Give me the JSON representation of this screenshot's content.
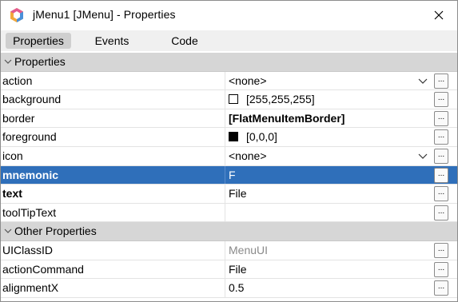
{
  "window": {
    "title": "jMenu1 [JMenu] - Properties"
  },
  "tabs": [
    {
      "label": "Properties",
      "active": true
    },
    {
      "label": "Events",
      "active": false
    },
    {
      "label": "Code",
      "active": false
    }
  ],
  "groups": {
    "properties": "Properties",
    "other": "Other Properties"
  },
  "properties": [
    {
      "name": "action",
      "value": "<none>",
      "dropdown": true
    },
    {
      "name": "background",
      "value": "[255,255,255]",
      "swatch": "#ffffff"
    },
    {
      "name": "border",
      "value": "[FlatMenuItemBorder]",
      "value_bold": true
    },
    {
      "name": "foreground",
      "value": "[0,0,0]",
      "swatch": "#000000"
    },
    {
      "name": "icon",
      "value": "<none>",
      "dropdown": true
    },
    {
      "name": "mnemonic",
      "value": "F",
      "name_bold": true,
      "selected": true
    },
    {
      "name": "text",
      "value": "File",
      "name_bold": true
    },
    {
      "name": "toolTipText",
      "value": ""
    }
  ],
  "other_properties": [
    {
      "name": "UIClassID",
      "value": "MenuUI",
      "read_only": true
    },
    {
      "name": "actionCommand",
      "value": "File"
    },
    {
      "name": "alignmentX",
      "value": "0.5"
    }
  ],
  "ellipsis_label": "...",
  "colors": {
    "selected": "#2f6fba",
    "group_header": "#d6d6d6",
    "active_tab": "#cfcfcf"
  }
}
